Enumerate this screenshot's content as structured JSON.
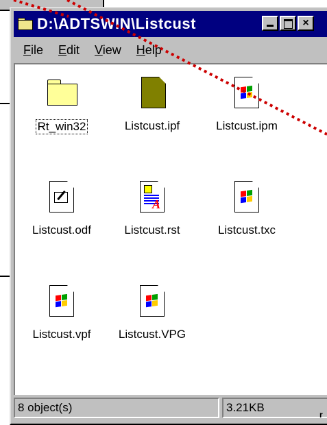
{
  "window": {
    "title": "D:\\ADTSWIN\\Listcust"
  },
  "menu": [
    {
      "label": "File",
      "underline": "F"
    },
    {
      "label": "Edit",
      "underline": "E"
    },
    {
      "label": "View",
      "underline": "V"
    },
    {
      "label": "Help",
      "underline": "H"
    }
  ],
  "files": [
    {
      "name": "Rt_win32",
      "icon": "folder-icon"
    },
    {
      "name": "Listcust.ipf",
      "icon": "olive-document-icon"
    },
    {
      "name": "Listcust.ipm",
      "icon": "windows-document-icon"
    },
    {
      "name": "Listcust.odf",
      "icon": "notepad-document-icon"
    },
    {
      "name": "Listcust.rst",
      "icon": "rich-text-document-icon"
    },
    {
      "name": "Listcust.txc",
      "icon": "windows-document-icon"
    },
    {
      "name": "Listcust.vpf",
      "icon": "windows-document-icon"
    },
    {
      "name": "Listcust.VPG",
      "icon": "windows-document-icon"
    }
  ],
  "status": {
    "objects": "8 object(s)",
    "size": "3.21KB"
  },
  "background": {
    "stub_text": "r"
  },
  "colors": {
    "titlebar": "#000080",
    "face": "#c0c0c0",
    "annotation": "#cc0000"
  }
}
